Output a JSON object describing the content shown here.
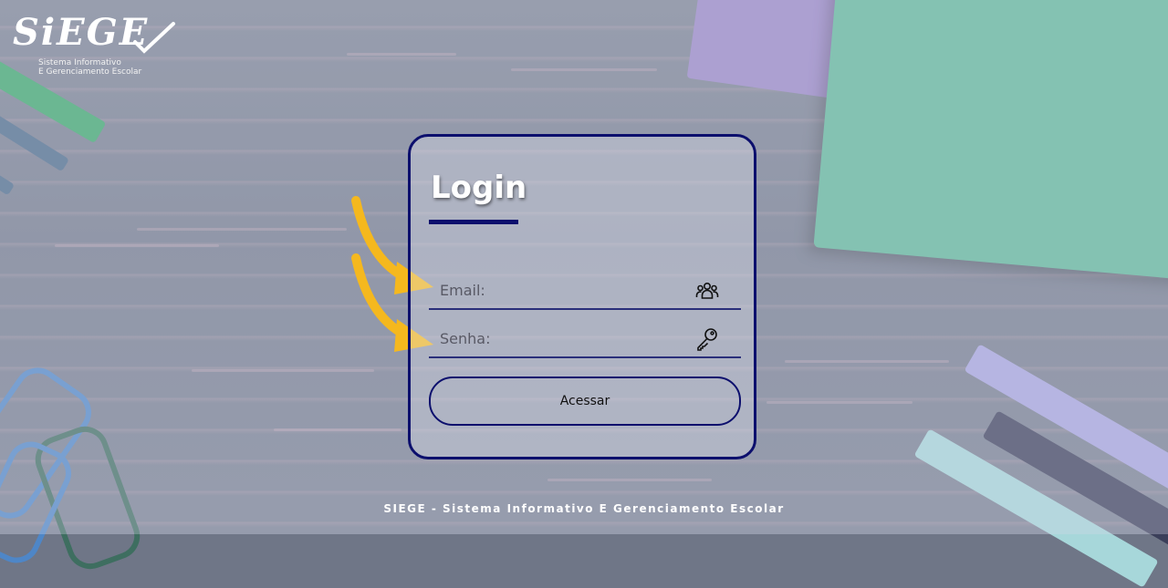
{
  "logo": {
    "mark": "SiEGE",
    "subtitle_line1": "Sistema Informativo",
    "subtitle_line2": "E Gerenciamento Escolar"
  },
  "login": {
    "title": "Login",
    "email": {
      "placeholder": "Email:",
      "value": "",
      "icon": "users-icon"
    },
    "senha": {
      "placeholder": "Senha:",
      "value": "",
      "icon": "key-icon"
    },
    "submit_label": "Acessar"
  },
  "colors": {
    "accent": "#0c0f6d",
    "arrow": "#f5b81e",
    "notebook_green": "#5fb89a",
    "notebook_purple": "#9a86c8"
  },
  "footer": {
    "text": "SIEGE - Sistema Informativo E Gerenciamento Escolar"
  }
}
